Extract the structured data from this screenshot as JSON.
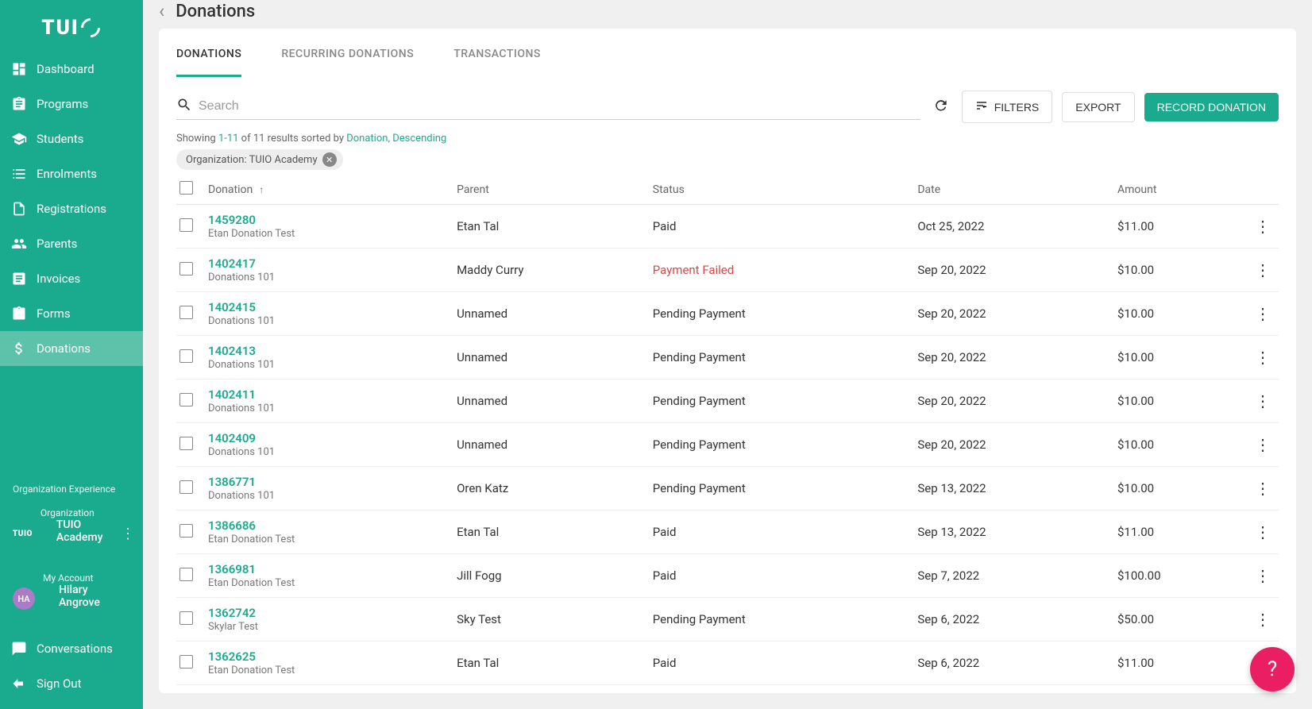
{
  "logo": "TUIO",
  "sidebar": {
    "items": [
      {
        "label": "Dashboard",
        "icon": "dashboard"
      },
      {
        "label": "Programs",
        "icon": "assignment"
      },
      {
        "label": "Students",
        "icon": "school"
      },
      {
        "label": "Enrolments",
        "icon": "list"
      },
      {
        "label": "Registrations",
        "icon": "doc"
      },
      {
        "label": "Parents",
        "icon": "people"
      },
      {
        "label": "Invoices",
        "icon": "receipt"
      },
      {
        "label": "Forms",
        "icon": "clipboard"
      },
      {
        "label": "Donations",
        "icon": "money",
        "active": true
      }
    ],
    "org_experience": "Organization Experience",
    "org": {
      "label": "Organization",
      "name": "TUIO Academy",
      "mini": "TUIO"
    },
    "account": {
      "label": "My Account",
      "name": "Hilary Angrove",
      "initials": "HA"
    },
    "conversations": "Conversations",
    "signout": "Sign Out"
  },
  "page": {
    "title": "Donations",
    "tabs": [
      {
        "label": "DONATIONS",
        "active": true
      },
      {
        "label": "RECURRING DONATIONS"
      },
      {
        "label": "TRANSACTIONS"
      }
    ],
    "search_placeholder": "Search",
    "filters_label": "FILTERS",
    "export_label": "EXPORT",
    "record_label": "RECORD DONATION",
    "results": {
      "prefix": "Showing ",
      "range": "1-11",
      "mid": " of 11 results sorted by ",
      "sort_field": "Donation",
      "sep": ", ",
      "dir": "Descending"
    },
    "chip": {
      "label": "Organization: TUIO Academy"
    },
    "columns": {
      "donation": "Donation",
      "parent": "Parent",
      "status": "Status",
      "date": "Date",
      "amount": "Amount"
    },
    "rows": [
      {
        "id": "1459280",
        "sub": "Etan Donation Test",
        "parent": "Etan Tal",
        "status": "Paid",
        "date": "Oct 25, 2022",
        "amount": "$11.00"
      },
      {
        "id": "1402417",
        "sub": "Donations 101",
        "parent": "Maddy Curry",
        "status": "Payment Failed",
        "status_failed": true,
        "date": "Sep 20, 2022",
        "amount": "$10.00"
      },
      {
        "id": "1402415",
        "sub": "Donations 101",
        "parent": "Unnamed",
        "status": "Pending Payment",
        "date": "Sep 20, 2022",
        "amount": "$10.00"
      },
      {
        "id": "1402413",
        "sub": "Donations 101",
        "parent": "Unnamed",
        "status": "Pending Payment",
        "date": "Sep 20, 2022",
        "amount": "$10.00"
      },
      {
        "id": "1402411",
        "sub": "Donations 101",
        "parent": "Unnamed",
        "status": "Pending Payment",
        "date": "Sep 20, 2022",
        "amount": "$10.00"
      },
      {
        "id": "1402409",
        "sub": "Donations 101",
        "parent": "Unnamed",
        "status": "Pending Payment",
        "date": "Sep 20, 2022",
        "amount": "$10.00"
      },
      {
        "id": "1386771",
        "sub": "Donations 101",
        "parent": "Oren Katz",
        "status": "Pending Payment",
        "date": "Sep 13, 2022",
        "amount": "$10.00"
      },
      {
        "id": "1386686",
        "sub": "Etan Donation Test",
        "parent": "Etan Tal",
        "status": "Paid",
        "date": "Sep 13, 2022",
        "amount": "$11.00"
      },
      {
        "id": "1366981",
        "sub": "Etan Donation Test",
        "parent": "Jill Fogg",
        "status": "Paid",
        "date": "Sep 7, 2022",
        "amount": "$100.00"
      },
      {
        "id": "1362742",
        "sub": "Skylar Test",
        "parent": "Sky Test",
        "status": "Pending Payment",
        "date": "Sep 6, 2022",
        "amount": "$50.00"
      },
      {
        "id": "1362625",
        "sub": "Etan Donation Test",
        "parent": "Etan Tal",
        "status": "Paid",
        "date": "Sep 6, 2022",
        "amount": "$11.00"
      }
    ]
  }
}
